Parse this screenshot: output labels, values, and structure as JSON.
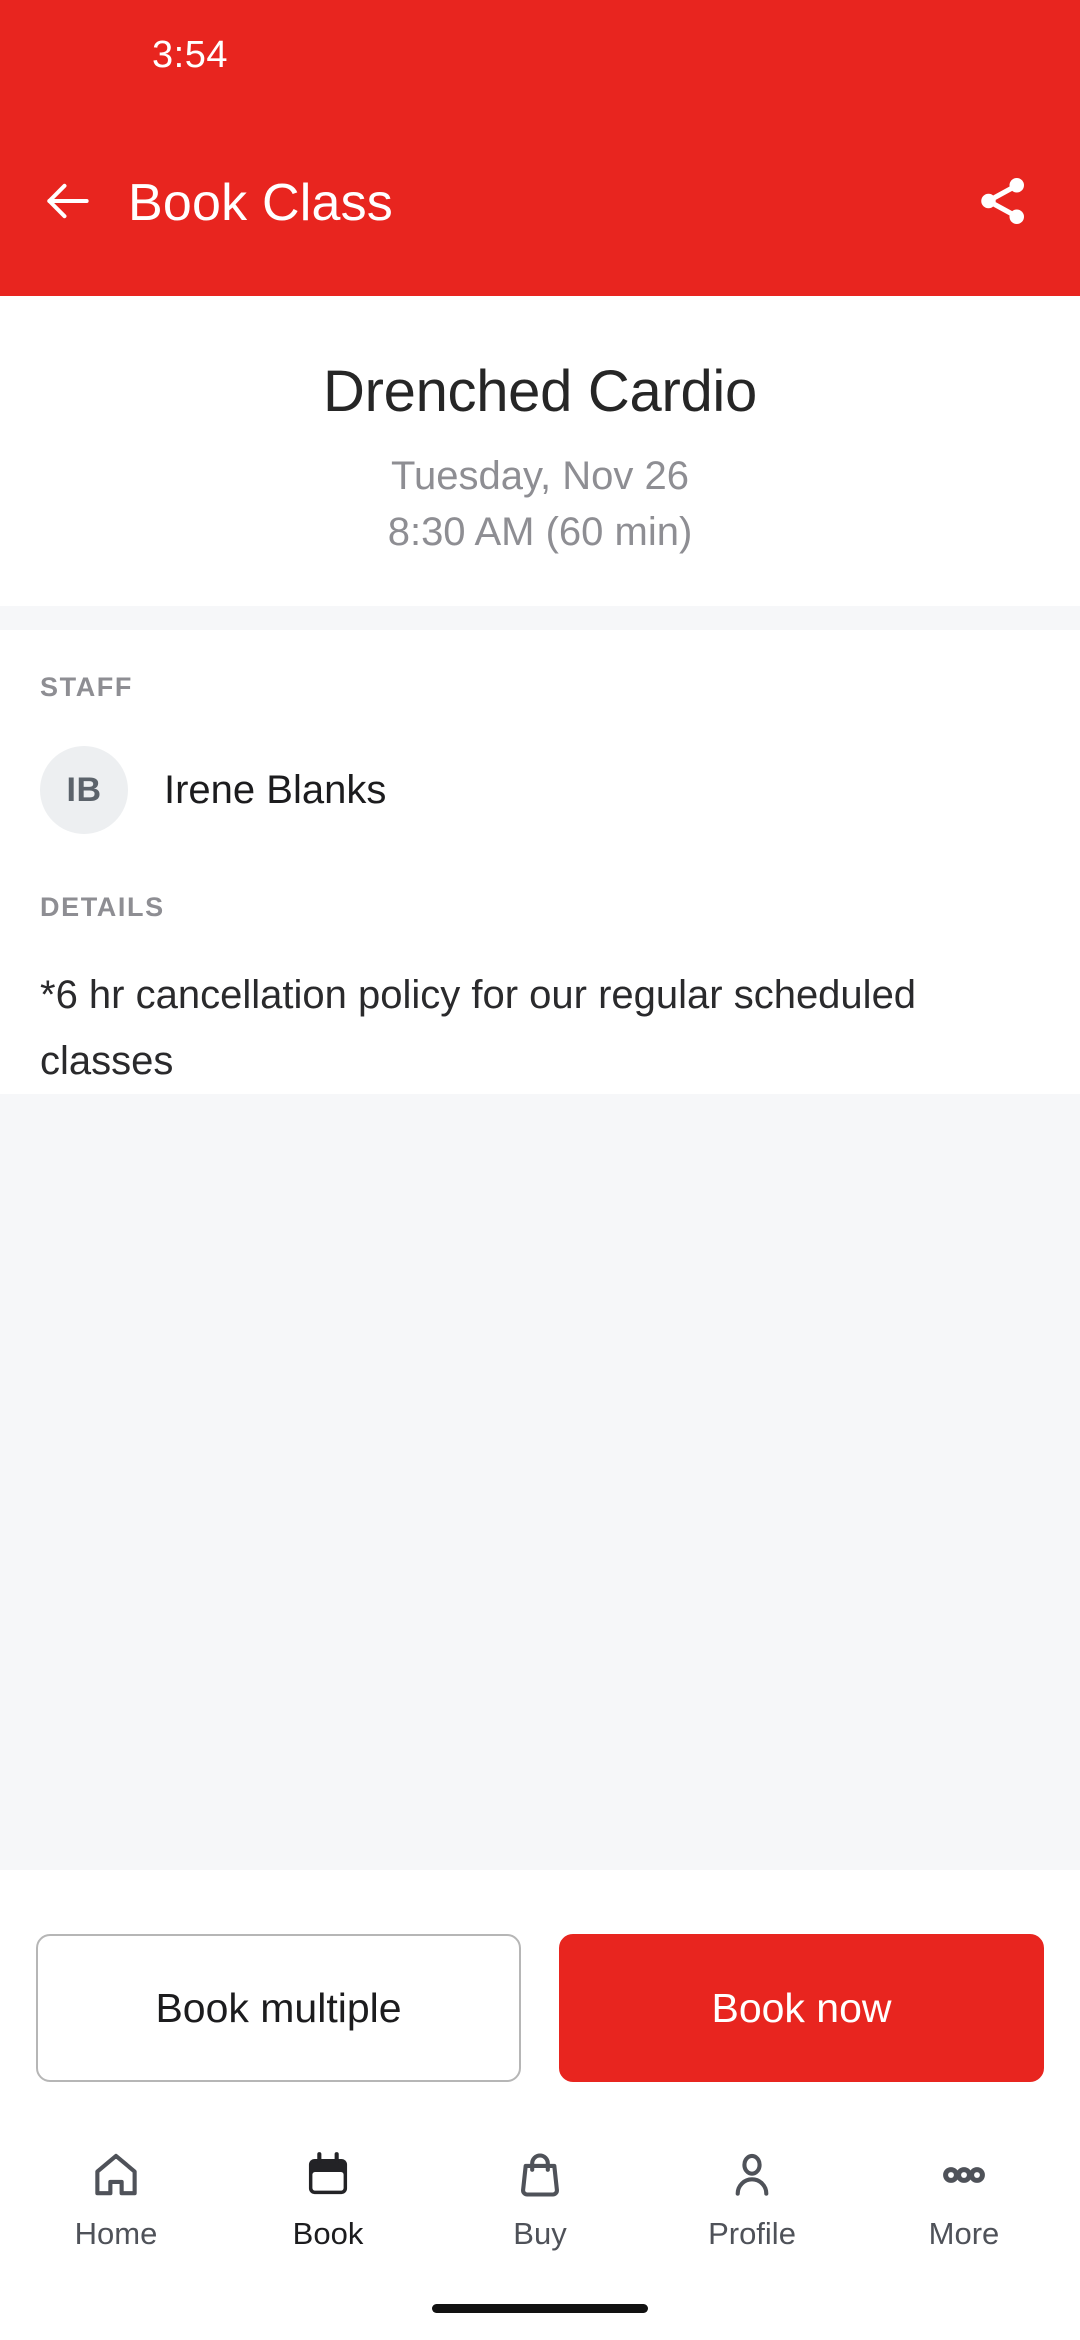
{
  "status_bar": {
    "time": "3:54"
  },
  "app_bar": {
    "title": "Book Class",
    "back_icon": "arrow-left-icon",
    "share_icon": "share-icon",
    "background_color": "#e8251f"
  },
  "summary": {
    "class_title": "Drenched Cardio",
    "date": "Tuesday, Nov 26",
    "time": "8:30 AM (60 min)"
  },
  "staff_section": {
    "label": "STAFF",
    "member": {
      "initials": "IB",
      "name": "Irene Blanks"
    }
  },
  "details_section": {
    "label": "DETAILS",
    "text": "*6 hr cancellation policy for our regular scheduled classes"
  },
  "actions": {
    "book_multiple_label": "Book multiple",
    "book_now_label": "Book now",
    "primary_color": "#e8251f"
  },
  "bottom_nav": {
    "items": [
      {
        "label": "Home",
        "icon": "home-icon",
        "active": false
      },
      {
        "label": "Book",
        "icon": "calendar-icon",
        "active": true
      },
      {
        "label": "Buy",
        "icon": "bag-icon",
        "active": false
      },
      {
        "label": "Profile",
        "icon": "person-icon",
        "active": false
      },
      {
        "label": "More",
        "icon": "dots-icon",
        "active": false
      }
    ]
  }
}
